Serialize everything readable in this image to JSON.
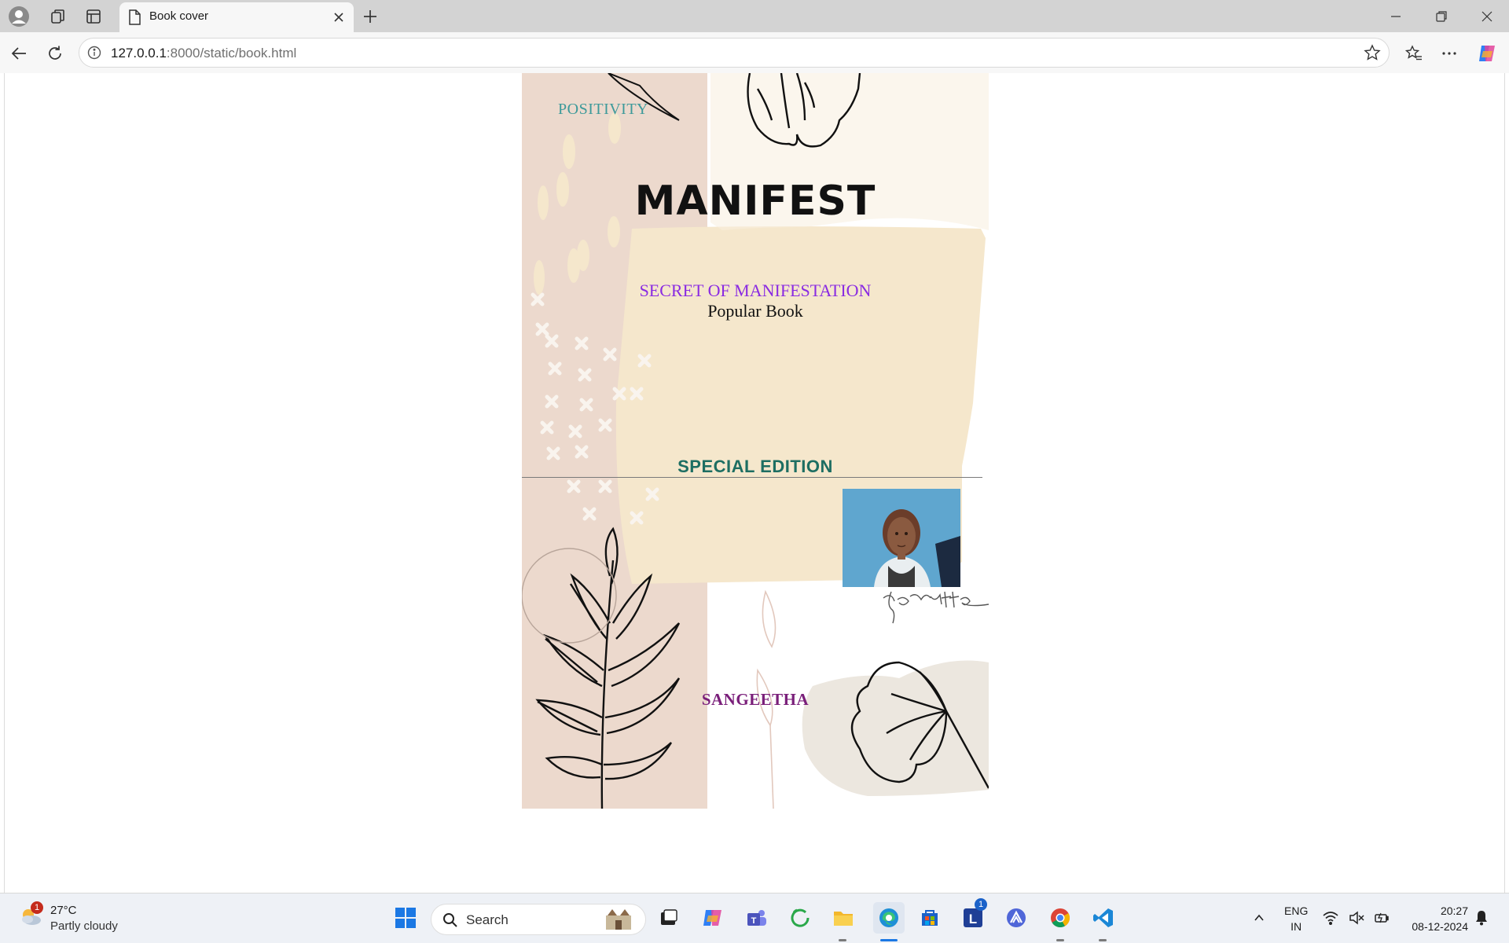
{
  "browser": {
    "tab_title": "Book cover",
    "url_host": "127.0.0.1",
    "url_rest": ":8000/static/book.html"
  },
  "cover": {
    "tagline": "POSITIVITY",
    "title": "MANIFEST",
    "subtitle": "SECRET OF MANIFESTATION",
    "subtitle2": "Popular Book",
    "edition": "SPECIAL EDITION",
    "author": "SANGEETHA",
    "colors": {
      "accent_teal": "#3d9a9a",
      "purple": "#8a2be2",
      "edition": "#1d6e62",
      "author": "#7a1f7a",
      "pink": "#ecd9cd",
      "cream": "#f5e7cc"
    }
  },
  "taskbar": {
    "temperature": "27°C",
    "weather": "Partly cloudy",
    "weather_badge": "1",
    "search_placeholder": "Search",
    "lang_line1": "ENG",
    "lang_line2": "IN",
    "time": "20:27",
    "date": "08-12-2024",
    "l_badge": "1"
  }
}
